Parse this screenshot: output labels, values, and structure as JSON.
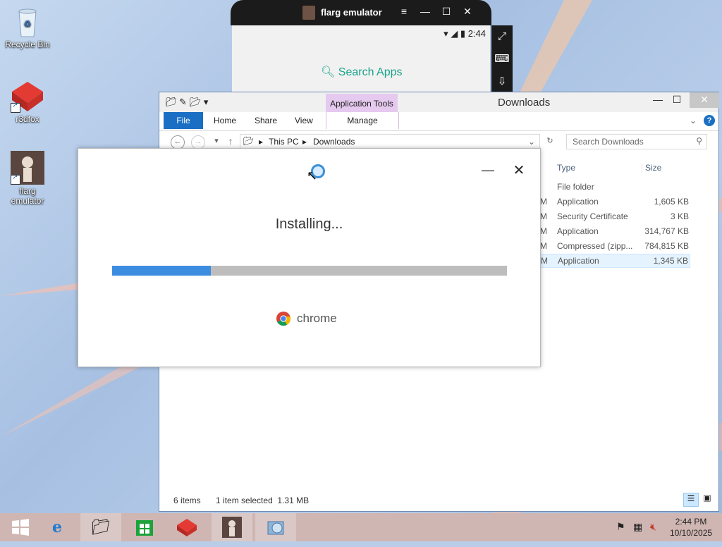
{
  "desktop": {
    "icons": [
      {
        "label": "Recycle Bin",
        "icon": "recycle-bin-icon"
      },
      {
        "label": "r3dfox",
        "icon": "r3dfox-icon"
      },
      {
        "label": "flarg emulator",
        "icon": "flarg-emulator-icon"
      }
    ]
  },
  "emulator": {
    "title": "flarg emulator",
    "time": "2:44",
    "search_label": "Search Apps"
  },
  "explorer": {
    "title": "Downloads",
    "context_tab": "Application Tools",
    "tabs": [
      "File",
      "Home",
      "Share",
      "View",
      "Manage"
    ],
    "breadcrumb": [
      "This PC",
      "Downloads"
    ],
    "search_placeholder": "Search Downloads",
    "columns": [
      "Type",
      "Size"
    ],
    "rows": [
      {
        "type": "File folder",
        "size": ""
      },
      {
        "type": "Application",
        "size": "1,605 KB"
      },
      {
        "type": "Security Certificate",
        "size": "3 KB"
      },
      {
        "type": "Application",
        "size": "314,767 KB"
      },
      {
        "type": "Compressed (zipp...",
        "size": "784,815 KB"
      },
      {
        "type": "Application",
        "size": "1,345 KB"
      }
    ],
    "status_items": "6 items",
    "status_selected": "1 item selected  1.31 MB"
  },
  "installer": {
    "status_text": "Installing...",
    "progress": 0.25,
    "brand": "chrome"
  },
  "taskbar": {
    "time": "2:44 PM",
    "date": "10/10/2025"
  },
  "colors": {
    "file_tab": "#1a6fc4",
    "context_tab": "#e5c9ef",
    "progress_fill": "#3c8de0",
    "taskbar": "#cfb6b2"
  }
}
